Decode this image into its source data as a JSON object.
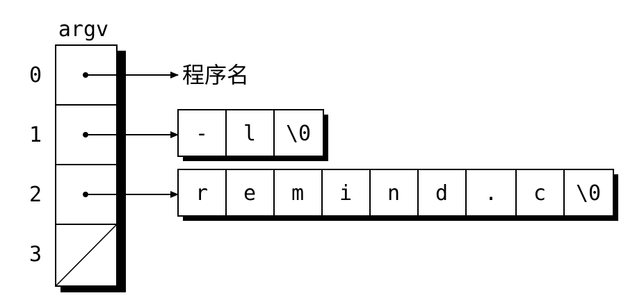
{
  "diagram": {
    "array_name": "argv",
    "indices": [
      "0",
      "1",
      "2",
      "3"
    ],
    "entries": [
      {
        "index": "0",
        "kind": "text",
        "target_text": "程序名"
      },
      {
        "index": "1",
        "kind": "chars",
        "chars": [
          "-",
          "l",
          "\\0"
        ]
      },
      {
        "index": "2",
        "kind": "chars",
        "chars": [
          "r",
          "e",
          "m",
          "i",
          "n",
          "d",
          ".",
          "c",
          "\\0"
        ]
      },
      {
        "index": "3",
        "kind": "null"
      }
    ]
  }
}
